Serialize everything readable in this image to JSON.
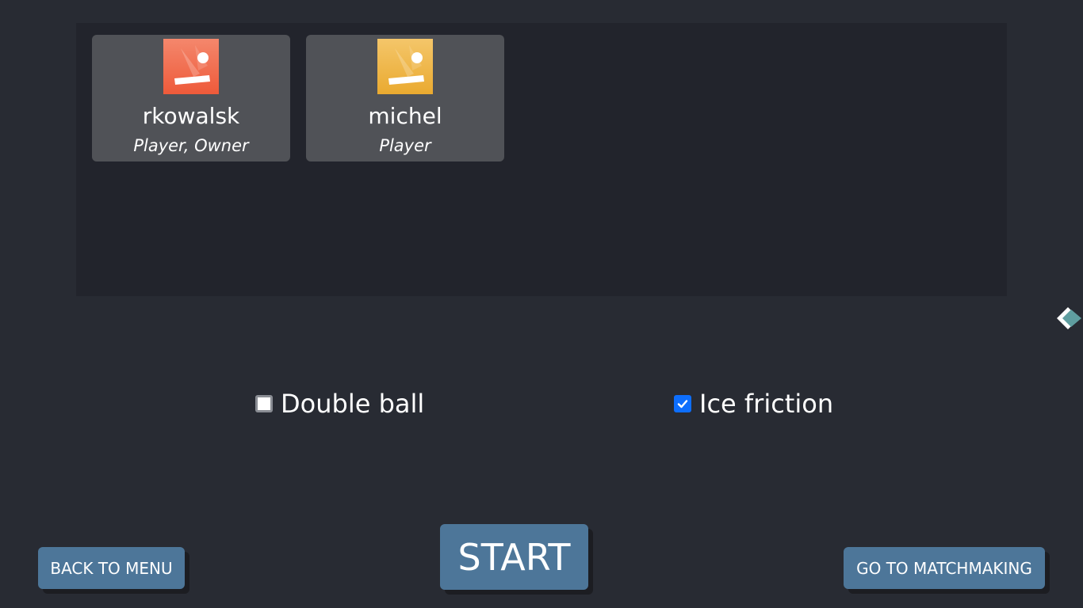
{
  "players": [
    {
      "name": "rkowalsk",
      "role": "Player, Owner",
      "avatar_icon": "pong-paddle-icon",
      "avatar_colors": [
        "#f0603f",
        "#f59480"
      ]
    },
    {
      "name": "michel",
      "role": "Player",
      "avatar_icon": "pong-paddle-icon",
      "avatar_colors": [
        "#ecb034",
        "#f5cf7c"
      ]
    }
  ],
  "options": {
    "double_ball": {
      "label": "Double ball",
      "checked": false
    },
    "ice_friction": {
      "label": "Ice friction",
      "checked": true
    }
  },
  "buttons": {
    "back_to_menu": "BACK TO MENU",
    "start": "START",
    "go_to_matchmaking": "GO TO MATCHMAKING"
  },
  "side_toggle": {
    "icon": "diamond-toggle-icon",
    "color": "#5f9ea0"
  },
  "colors": {
    "background": "#282b33",
    "panel": "#22242c",
    "card": "#505257",
    "button": "#4d7699",
    "checkbox_checked": "#0d6efd"
  }
}
